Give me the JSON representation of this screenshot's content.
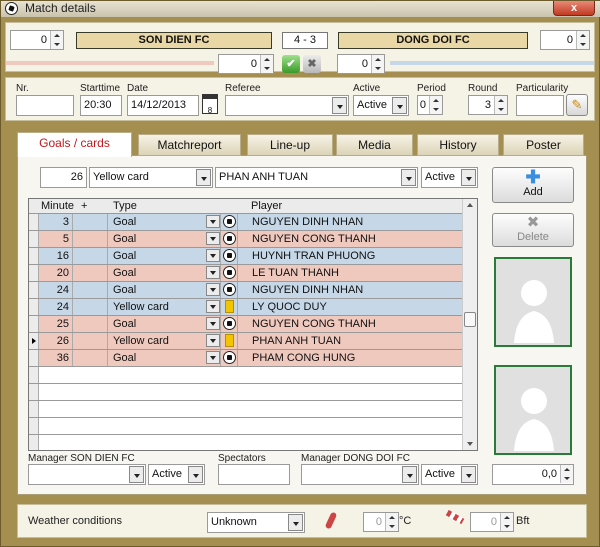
{
  "window": {
    "title": "Match details",
    "close": "x"
  },
  "header": {
    "home_team": "SON DIEN FC",
    "away_team": "DONG DOI FC",
    "score": "4 - 3",
    "home_left_value": "0",
    "away_right_value": "0",
    "home_sub_value": "0",
    "away_sub_value": "0"
  },
  "info": {
    "nr_label": "Nr.",
    "nr_value": "",
    "starttime_label": "Starttime",
    "starttime_value": "20:30",
    "date_label": "Date",
    "date_value": "14/12/2013",
    "referee_label": "Referee",
    "referee_value": "",
    "active_label": "Active",
    "active_value": "Active",
    "period_label": "Period",
    "period_value": "0",
    "round_label": "Round",
    "round_value": "3",
    "particularity_label": "Particularity",
    "particularity_value": ""
  },
  "tabs": [
    "Goals / cards",
    "Matchreport",
    "Line-up",
    "Media",
    "History",
    "Poster"
  ],
  "entry": {
    "minute": "26",
    "type": "Yellow card",
    "player": "PHAN ANH TUAN",
    "status": "Active"
  },
  "buttons": {
    "add": "Add",
    "delete": "Delete"
  },
  "grid": {
    "headers": {
      "minute": "Minute",
      "plus": "+",
      "type": "Type",
      "player": "Player"
    },
    "rows": [
      {
        "minute": "3",
        "type": "Goal",
        "player": "NGUYEN DINH NHAN",
        "team": "home",
        "icon": "ball-icon"
      },
      {
        "minute": "5",
        "type": "Goal",
        "player": "NGUYEN CONG THANH",
        "team": "away",
        "icon": "ball-icon"
      },
      {
        "minute": "16",
        "type": "Goal",
        "player": "HUYNH TRAN PHUONG",
        "team": "home",
        "icon": "ball-icon"
      },
      {
        "minute": "20",
        "type": "Goal",
        "player": "LE TUAN THANH",
        "team": "away",
        "icon": "ball-icon"
      },
      {
        "minute": "24",
        "type": "Goal",
        "player": "NGUYEN DINH NHAN",
        "team": "home",
        "icon": "ball-icon"
      },
      {
        "minute": "24",
        "type": "Yellow card",
        "player": "LY QUOC DUY",
        "team": "home",
        "icon": "yellow-card-icon"
      },
      {
        "minute": "25",
        "type": "Goal",
        "player": "NGUYEN CONG THANH",
        "team": "away",
        "icon": "ball-icon"
      },
      {
        "minute": "26",
        "type": "Yellow card",
        "player": "PHAN ANH TUAN",
        "team": "away",
        "icon": "yellow-card-icon",
        "selected": true
      },
      {
        "minute": "36",
        "type": "Goal",
        "player": "PHAM CONG HUNG",
        "team": "away",
        "icon": "ball-icon"
      }
    ]
  },
  "bottom": {
    "manager_home_label": "Manager SON DIEN FC",
    "manager_home_value": "",
    "manager_home_status": "Active",
    "spectators_label": "Spectators",
    "spectators_value": "",
    "manager_away_label": "Manager DONG DOI FC",
    "manager_away_value": "",
    "manager_away_status": "Active",
    "rating_value": "0,0"
  },
  "weather": {
    "label": "Weather conditions",
    "condition": "Unknown",
    "temp_value": "0",
    "temp_unit": "°C",
    "wind_value": "0",
    "wind_unit": "Bft"
  },
  "colors": {
    "home_row": "#c6d8e8",
    "away_row": "#f0c9be",
    "team_box": "#e9d8a6",
    "frame": "#a48f50",
    "active_tab": "#c0181d"
  }
}
